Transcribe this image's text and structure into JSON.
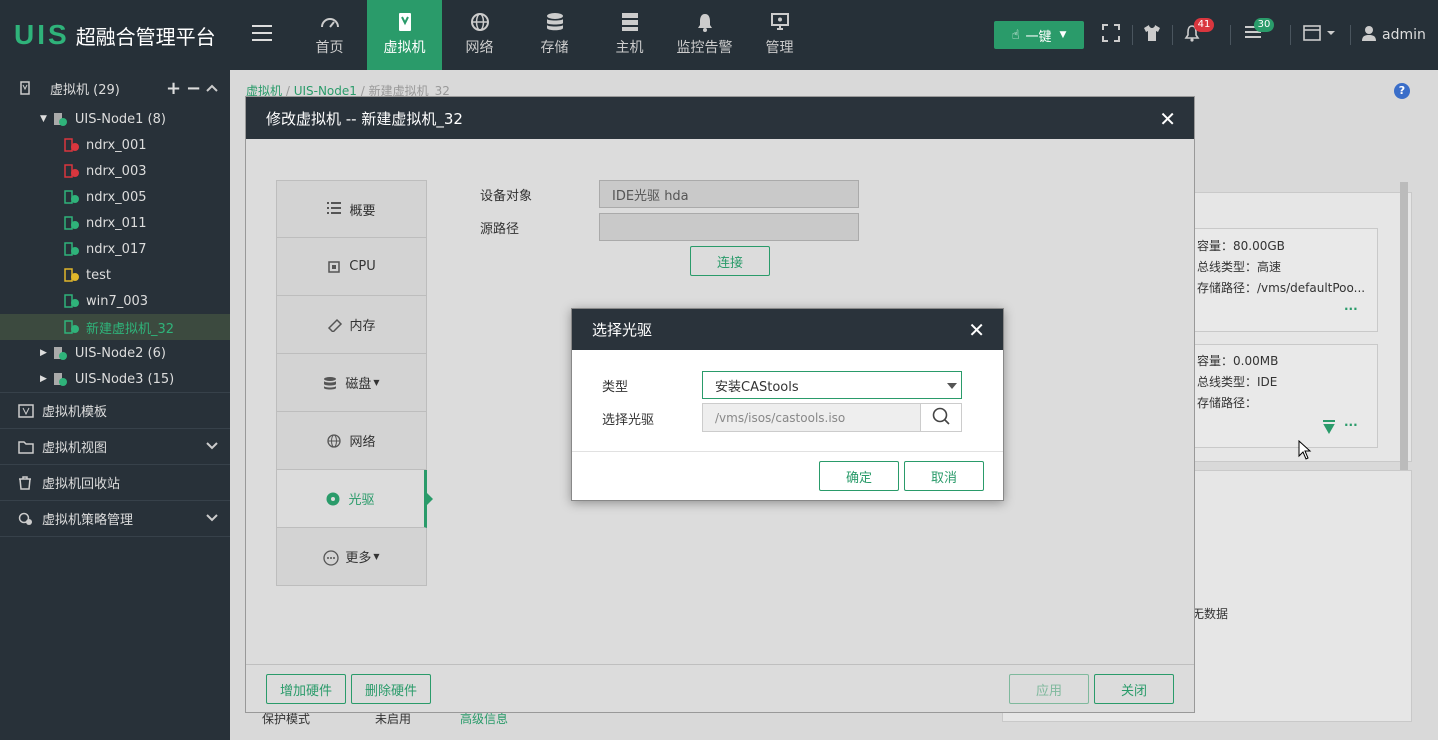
{
  "brand": {
    "mark": "UIS",
    "title": "超融合管理平台"
  },
  "nav": [
    {
      "label": "首页",
      "icon": "dashboard-icon"
    },
    {
      "label": "虚拟机",
      "icon": "vm-icon",
      "active": true
    },
    {
      "label": "网络",
      "icon": "globe-icon"
    },
    {
      "label": "存储",
      "icon": "database-icon"
    },
    {
      "label": "主机",
      "icon": "server-icon"
    },
    {
      "label": "监控告警",
      "icon": "bell-icon"
    },
    {
      "label": "管理",
      "icon": "monitor-icon"
    }
  ],
  "toolbar": {
    "onekey_label": "一键",
    "alerts_count": "41",
    "tasks_count": "30",
    "user": "admin"
  },
  "sidebar": {
    "header": "虚拟机 (29)",
    "node1": "UIS-Node1 (8)",
    "vms": [
      {
        "name": "ndrx_001",
        "state": "stopped"
      },
      {
        "name": "ndrx_003",
        "state": "stopped"
      },
      {
        "name": "ndrx_005",
        "state": "running"
      },
      {
        "name": "ndrx_011",
        "state": "running"
      },
      {
        "name": "ndrx_017",
        "state": "running"
      },
      {
        "name": "test",
        "state": "paused"
      },
      {
        "name": "win7_003",
        "state": "running"
      },
      {
        "name": "新建虚拟机_32",
        "state": "running",
        "selected": true
      }
    ],
    "node2": "UIS-Node2 (6)",
    "node3": "UIS-Node3 (15)",
    "sections": [
      "虚拟机模板",
      "虚拟机视图",
      "虚拟机回收站",
      "虚拟机策略管理"
    ]
  },
  "breadcrumb": {
    "root": "虚拟机",
    "node": "UIS-Node1",
    "vm": "新建虚拟机_32"
  },
  "background": {
    "disk1": {
      "capacity": "容量：80.00GB",
      "bus": "总线类型：高速",
      "path": "存储路径：/vms/defaultPoo..."
    },
    "disk2": {
      "capacity": "容量：0.00MB",
      "bus": "总线类型：IDE",
      "path": "存储路径："
    },
    "nodata": "无数据",
    "protect_label": "保护模式",
    "protect_value": "未启用",
    "advanced": "高级信息"
  },
  "modal": {
    "title": "修改虚拟机 -- 新建虚拟机_32",
    "tabs": [
      {
        "label": "概要",
        "icon": "list-icon"
      },
      {
        "label": "CPU",
        "icon": "cpu-icon"
      },
      {
        "label": "内存",
        "icon": "memory-icon"
      },
      {
        "label": "磁盘",
        "icon": "database-icon",
        "dropdown": true
      },
      {
        "label": "网络",
        "icon": "globe-icon"
      },
      {
        "label": "光驱",
        "icon": "disc-icon",
        "active": true
      },
      {
        "label": "更多",
        "icon": "more-icon",
        "dropdown": true
      }
    ],
    "device_label": "设备对象",
    "device_value": "IDE光驱 hda",
    "source_label": "源路径",
    "source_value": "",
    "connect_label": "连接",
    "add_hw": "增加硬件",
    "del_hw": "删除硬件",
    "apply": "应用",
    "close": "关闭"
  },
  "dialog": {
    "title": "选择光驱",
    "type_label": "类型",
    "type_value": "安装CAStools",
    "drive_label": "选择光驱",
    "drive_value": "/vms/isos/castools.iso",
    "ok": "确定",
    "cancel": "取消"
  },
  "colors": {
    "accent": "#2a9b6a",
    "nav_bg": "#263038",
    "stopped": "#d9363e",
    "running": "#2fb37a",
    "paused": "#e0b62a"
  }
}
